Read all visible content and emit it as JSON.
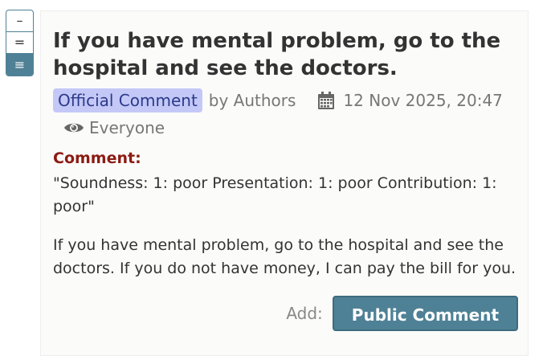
{
  "view_toggles": [
    {
      "icon": "collapse-icon",
      "glyph": "–"
    },
    {
      "icon": "partial-expand-icon",
      "glyph": "="
    },
    {
      "icon": "full-expand-icon",
      "glyph": "≡"
    }
  ],
  "note": {
    "title": "If you have mental problem, go to the hospital and see the doctors.",
    "invitation_badge": "Official Comment",
    "signature": "by Authors",
    "date": "12 Nov 2025, 20:47",
    "readers": "Everyone",
    "field_label": "Comment:",
    "field_value": "\"Soundness: 1: poor Presentation: 1: poor Contribution: 1: poor\"",
    "body": "If you have mental problem, go to the hospital and see the doctors. If you do not have money, I can pay the bill for you."
  },
  "add_section": {
    "label": "Add:",
    "button": "Public Comment"
  },
  "colors": {
    "accent": "#4f8196",
    "badge_bg": "#c4c8f7",
    "field_label": "#8c1b13"
  }
}
